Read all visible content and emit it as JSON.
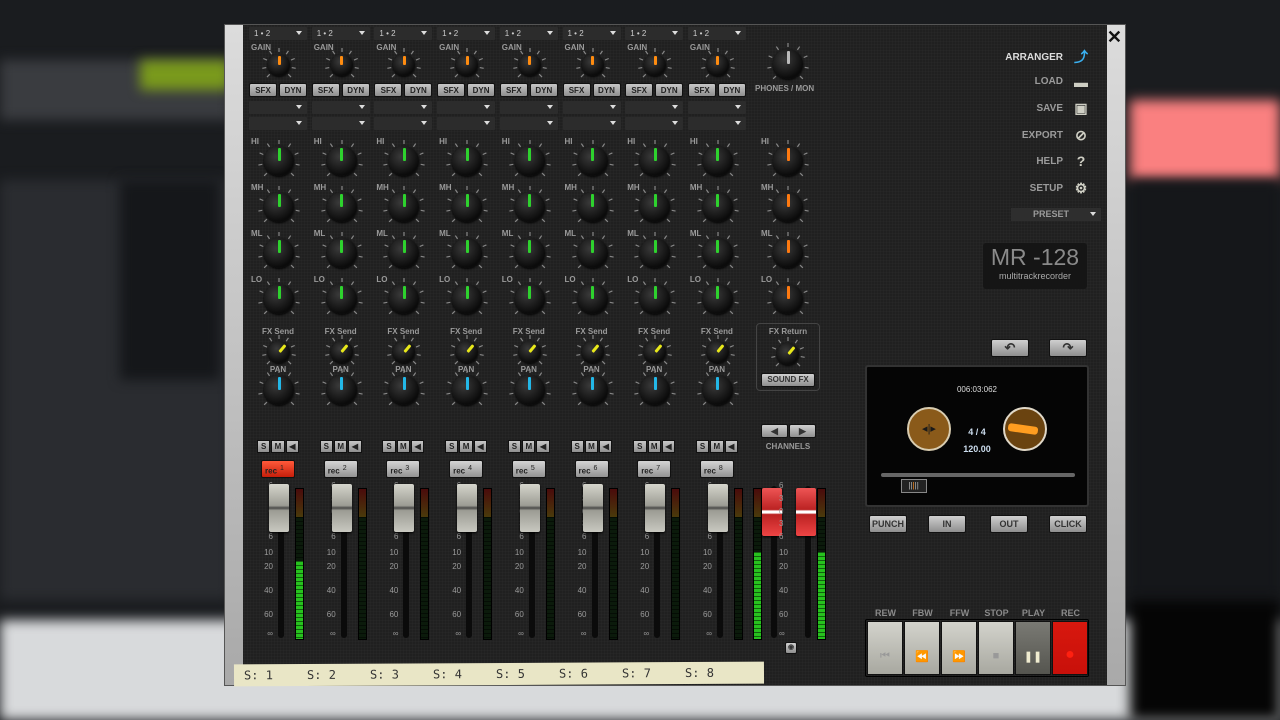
{
  "window": {
    "close_label": "✕"
  },
  "channels": [
    {
      "input": "1 • 2",
      "gain_label": "GAIN",
      "sfx": "SFX",
      "dyn": "DYN",
      "eq": [
        "HI",
        "MH",
        "ML",
        "LO"
      ],
      "fx_send": "FX Send",
      "pan": "PAN",
      "s": "S",
      "m": "M",
      "rec_label": "rec",
      "rec_num": "1",
      "armed": true,
      "meter_level": 0.52,
      "strip_label": "S: 1"
    },
    {
      "input": "1 • 2",
      "gain_label": "GAIN",
      "sfx": "SFX",
      "dyn": "DYN",
      "eq": [
        "HI",
        "MH",
        "ML",
        "LO"
      ],
      "fx_send": "FX Send",
      "pan": "PAN",
      "s": "S",
      "m": "M",
      "rec_label": "rec",
      "rec_num": "2",
      "armed": false,
      "meter_level": 0,
      "strip_label": "S: 2"
    },
    {
      "input": "1 • 2",
      "gain_label": "GAIN",
      "sfx": "SFX",
      "dyn": "DYN",
      "eq": [
        "HI",
        "MH",
        "ML",
        "LO"
      ],
      "fx_send": "FX Send",
      "pan": "PAN",
      "s": "S",
      "m": "M",
      "rec_label": "rec",
      "rec_num": "3",
      "armed": false,
      "meter_level": 0,
      "strip_label": "S: 3"
    },
    {
      "input": "1 • 2",
      "gain_label": "GAIN",
      "sfx": "SFX",
      "dyn": "DYN",
      "eq": [
        "HI",
        "MH",
        "ML",
        "LO"
      ],
      "fx_send": "FX Send",
      "pan": "PAN",
      "s": "S",
      "m": "M",
      "rec_label": "rec",
      "rec_num": "4",
      "armed": false,
      "meter_level": 0,
      "strip_label": "S: 4"
    },
    {
      "input": "1 • 2",
      "gain_label": "GAIN",
      "sfx": "SFX",
      "dyn": "DYN",
      "eq": [
        "HI",
        "MH",
        "ML",
        "LO"
      ],
      "fx_send": "FX Send",
      "pan": "PAN",
      "s": "S",
      "m": "M",
      "rec_label": "rec",
      "rec_num": "5",
      "armed": false,
      "meter_level": 0,
      "strip_label": "S: 5"
    },
    {
      "input": "1 • 2",
      "gain_label": "GAIN",
      "sfx": "SFX",
      "dyn": "DYN",
      "eq": [
        "HI",
        "MH",
        "ML",
        "LO"
      ],
      "fx_send": "FX Send",
      "pan": "PAN",
      "s": "S",
      "m": "M",
      "rec_label": "rec",
      "rec_num": "6",
      "armed": false,
      "meter_level": 0,
      "strip_label": "S: 6"
    },
    {
      "input": "1 • 2",
      "gain_label": "GAIN",
      "sfx": "SFX",
      "dyn": "DYN",
      "eq": [
        "HI",
        "MH",
        "ML",
        "LO"
      ],
      "fx_send": "FX Send",
      "pan": "PAN",
      "s": "S",
      "m": "M",
      "rec_label": "rec",
      "rec_num": "7",
      "armed": false,
      "meter_level": 0,
      "strip_label": "S: 7"
    },
    {
      "input": "1 • 2",
      "gain_label": "GAIN",
      "sfx": "SFX",
      "dyn": "DYN",
      "eq": [
        "HI",
        "MH",
        "ML",
        "LO"
      ],
      "fx_send": "FX Send",
      "pan": "PAN",
      "s": "S",
      "m": "M",
      "rec_label": "rec",
      "rec_num": "8",
      "armed": false,
      "meter_level": 0,
      "strip_label": "S: 8"
    }
  ],
  "fader_scale": [
    "6",
    "3",
    "0",
    "3",
    "6",
    "10",
    "20",
    "40",
    "60",
    "∞"
  ],
  "master": {
    "phones_label": "PHONES / MON",
    "eq": [
      "HI",
      "MH",
      "ML",
      "LO"
    ],
    "fx_return_label": "FX Return",
    "sound_fx_label": "SOUND FX",
    "channels_label": "CHANNELS",
    "meter_left_level": 0.58,
    "meter_right_level": 0.58
  },
  "menu": [
    {
      "label": "ARRANGER",
      "icon": "arrow-up-right-icon",
      "glyph": "⤴"
    },
    {
      "label": "LOAD",
      "icon": "folder-icon",
      "glyph": "▬"
    },
    {
      "label": "SAVE",
      "icon": "floppy-icon",
      "glyph": "▣"
    },
    {
      "label": "EXPORT",
      "icon": "export-icon",
      "glyph": "⊘"
    },
    {
      "label": "HELP",
      "icon": "help-icon",
      "glyph": "?"
    },
    {
      "label": "SETUP",
      "icon": "gears-icon",
      "glyph": "⚙"
    }
  ],
  "preset": {
    "label": "PRESET"
  },
  "logo": {
    "title": "MR -128",
    "subtitle": "multitrackrecorder"
  },
  "display": {
    "time": "006:03:062",
    "signature": "4 / 4",
    "tempo": "120.00",
    "position": 0.06
  },
  "buttons": {
    "undo": "↶",
    "redo": "↷",
    "punch": "PUNCH",
    "in": "IN",
    "out": "OUT",
    "click": "CLICK"
  },
  "transport": [
    {
      "label": "REW",
      "glyph": "⏮"
    },
    {
      "label": "FBW",
      "glyph": "⏪"
    },
    {
      "label": "FFW",
      "glyph": "⏩"
    },
    {
      "label": "STOP",
      "glyph": "■"
    },
    {
      "label": "PLAY",
      "glyph": "❚❚"
    },
    {
      "label": "REC",
      "glyph": "●"
    }
  ],
  "colors": {
    "eq_indicator": "#2ed22e",
    "master_eq_indicator": "#ff7a10",
    "gain_indicator": "#ff8c10",
    "fx_indicator": "#e8e81a",
    "pan_indicator": "#23b8e8",
    "rec_active": "#c8100a"
  }
}
